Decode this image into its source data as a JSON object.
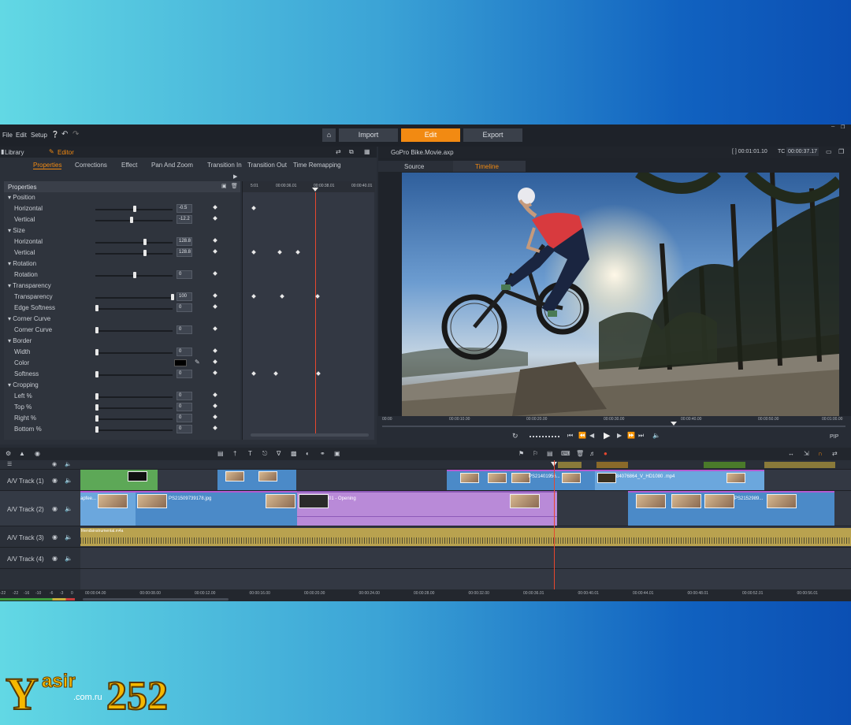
{
  "menu": {
    "file": "File",
    "edit": "Edit",
    "setup": "Setup"
  },
  "nav": {
    "import": "Import",
    "edit": "Edit",
    "export": "Export"
  },
  "left_tabs": {
    "library": "Library",
    "editor": "Editor"
  },
  "sub_tabs": [
    "Properties",
    "Corrections",
    "Effect",
    "Pan And Zoom",
    "Transition In",
    "Transition Out",
    "Time Remapping"
  ],
  "properties": {
    "header": "Properties",
    "rows": [
      {
        "label": "Position",
        "section": true
      },
      {
        "label": "Horizontal",
        "value": "-0.5",
        "pos": 0.5
      },
      {
        "label": "Vertical",
        "value": "-12.2",
        "pos": 0.46
      },
      {
        "label": "Size",
        "section": true
      },
      {
        "label": "Horizontal",
        "value": "128.8",
        "pos": 0.64
      },
      {
        "label": "Vertical",
        "value": "128.8",
        "pos": 0.64
      },
      {
        "label": "Rotation",
        "section": true
      },
      {
        "label": "Rotation",
        "value": "0",
        "pos": 0.5
      },
      {
        "label": "Transparency",
        "section": true
      },
      {
        "label": "Transparency",
        "value": "100",
        "pos": 1.0
      },
      {
        "label": "Edge Softness",
        "value": "0",
        "pos": 0.0
      },
      {
        "label": "Corner Curve",
        "section": true
      },
      {
        "label": "Corner Curve",
        "value": "0",
        "pos": 0.0
      },
      {
        "label": "Border",
        "section": true
      },
      {
        "label": "Width",
        "value": "0",
        "pos": 0.0
      },
      {
        "label": "Color",
        "color": "#000000"
      },
      {
        "label": "Softness",
        "value": "0",
        "pos": 0.0
      },
      {
        "label": "Cropping",
        "section": true
      },
      {
        "label": "Left %",
        "value": "0",
        "pos": 0.0
      },
      {
        "label": "Top %",
        "value": "0",
        "pos": 0.0
      },
      {
        "label": "Right %",
        "value": "0",
        "pos": 0.0
      },
      {
        "label": "Bottom %",
        "value": "0",
        "pos": 0.0
      }
    ]
  },
  "keyframe_ruler": [
    "5:01",
    "00:00:36.01",
    "00:00:38.01",
    "00:00:40.01"
  ],
  "preview": {
    "title": "GoPro Bike.Movie.axp",
    "duration": "[ ] 00:01:01.10",
    "tc_label": "TC",
    "timecode": "00:00:37.17",
    "tab_source": "Source",
    "tab_timeline": "Timeline",
    "ruler": [
      "00:00",
      "00:00:10.00",
      "00:00:20.00",
      "00:00:30.00",
      "00:00:40.00",
      "00:00:50.00",
      "00:01:00.00"
    ],
    "pip_label": "PIP"
  },
  "tracks": [
    {
      "name": "A/V Track (1)"
    },
    {
      "name": "A/V Track (2)"
    },
    {
      "name": "A/V Track (3)"
    },
    {
      "name": "A/V Track (4)"
    }
  ],
  "clips": {
    "t1_c3": "PS21401956...",
    "t1_c4": "84076864_V_HD1080 .mp4",
    "t2_c1": "apfee...",
    "t2_c2": "PS21509739178.jpg",
    "t2_c3": "01 - Opening",
    "t2_c4": "PS2152989...",
    "t3_audio": "friendsinstrumental.m4a"
  },
  "timeline_ruler": [
    "00:00:04.00",
    "00:00:08.00",
    "00:00:12.00",
    "00:00:16.00",
    "00:00:20.00",
    "00:00:24.00",
    "00:00:28.00",
    "00:00:32.00",
    "00:00:36.01",
    "00:00:40.01",
    "00:00:44.01",
    "00:00:48.01",
    "00:00:52.01",
    "00:00:56.01"
  ],
  "meter_ticks": [
    "-22",
    "-16",
    "-10",
    "-6",
    "-3",
    "0"
  ],
  "watermark": {
    "main": "Yasir252",
    "sub": ".com.ru"
  },
  "colors": {
    "accent": "#f28a12",
    "playhead": "#e8472e",
    "clip_blue": "#4b8ac8",
    "clip_purple": "#b98ad8",
    "clip_green": "#5da857",
    "audio_gold": "#b9a24f"
  }
}
